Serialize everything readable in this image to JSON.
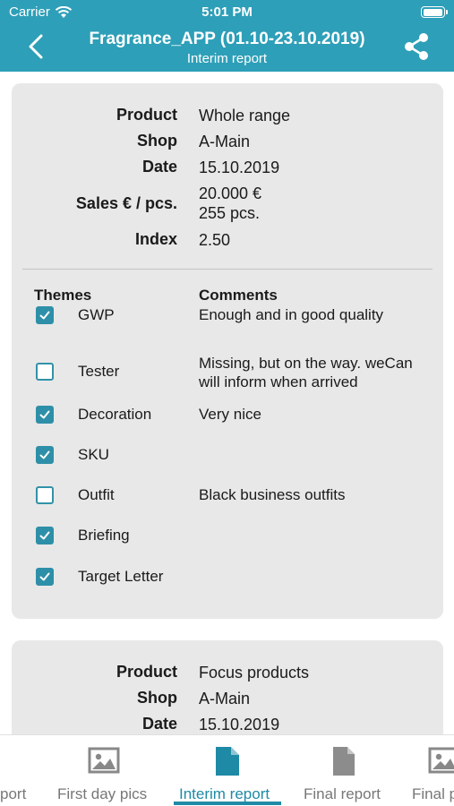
{
  "status_bar": {
    "carrier": "Carrier",
    "time": "5:01 PM"
  },
  "header": {
    "title": "Fragrance_APP (01.10-23.10.2019)",
    "subtitle": "Interim report",
    "back_icon": "chevron-left-icon",
    "share_icon": "share-icon"
  },
  "card1": {
    "product_label": "Product",
    "product": "Whole range",
    "shop_label": "Shop",
    "shop": "A-Main",
    "date_label": "Date",
    "date": "15.10.2019",
    "sales_label": "Sales € / pcs.",
    "sales_eur": "20.000 €",
    "sales_pcs": "255 pcs.",
    "index_label": "Index",
    "index": "2.50",
    "themes_header": "Themes",
    "comments_header": "Comments",
    "themes": [
      {
        "name": "GWP",
        "checked": true,
        "comment": "Enough and in good quality"
      },
      {
        "name": "Tester",
        "checked": false,
        "comment": "Missing, but on the way. weCan will inform when arrived"
      },
      {
        "name": "Decoration",
        "checked": true,
        "comment": "Very nice"
      },
      {
        "name": "SKU",
        "checked": true,
        "comment": ""
      },
      {
        "name": "Outfit",
        "checked": false,
        "comment": "Black business outfits"
      },
      {
        "name": "Briefing",
        "checked": true,
        "comment": ""
      },
      {
        "name": "Target Letter",
        "checked": true,
        "comment": ""
      }
    ]
  },
  "card2": {
    "product_label": "Product",
    "product": "Focus products",
    "shop_label": "Shop",
    "shop": "A-Main",
    "date_label": "Date",
    "date": "15.10.2019"
  },
  "tabs": [
    {
      "label": "port",
      "icon": "image-icon",
      "active": false
    },
    {
      "label": "First day pics",
      "icon": "image-icon",
      "active": false
    },
    {
      "label": "Interim report",
      "icon": "document-icon",
      "active": true
    },
    {
      "label": "Final report",
      "icon": "document-icon",
      "active": false
    },
    {
      "label": "Final p",
      "icon": "image-icon",
      "active": false
    }
  ],
  "colors": {
    "header": "#2e9fb8",
    "accent": "#1e8aa6",
    "card": "#e8e8e8"
  }
}
